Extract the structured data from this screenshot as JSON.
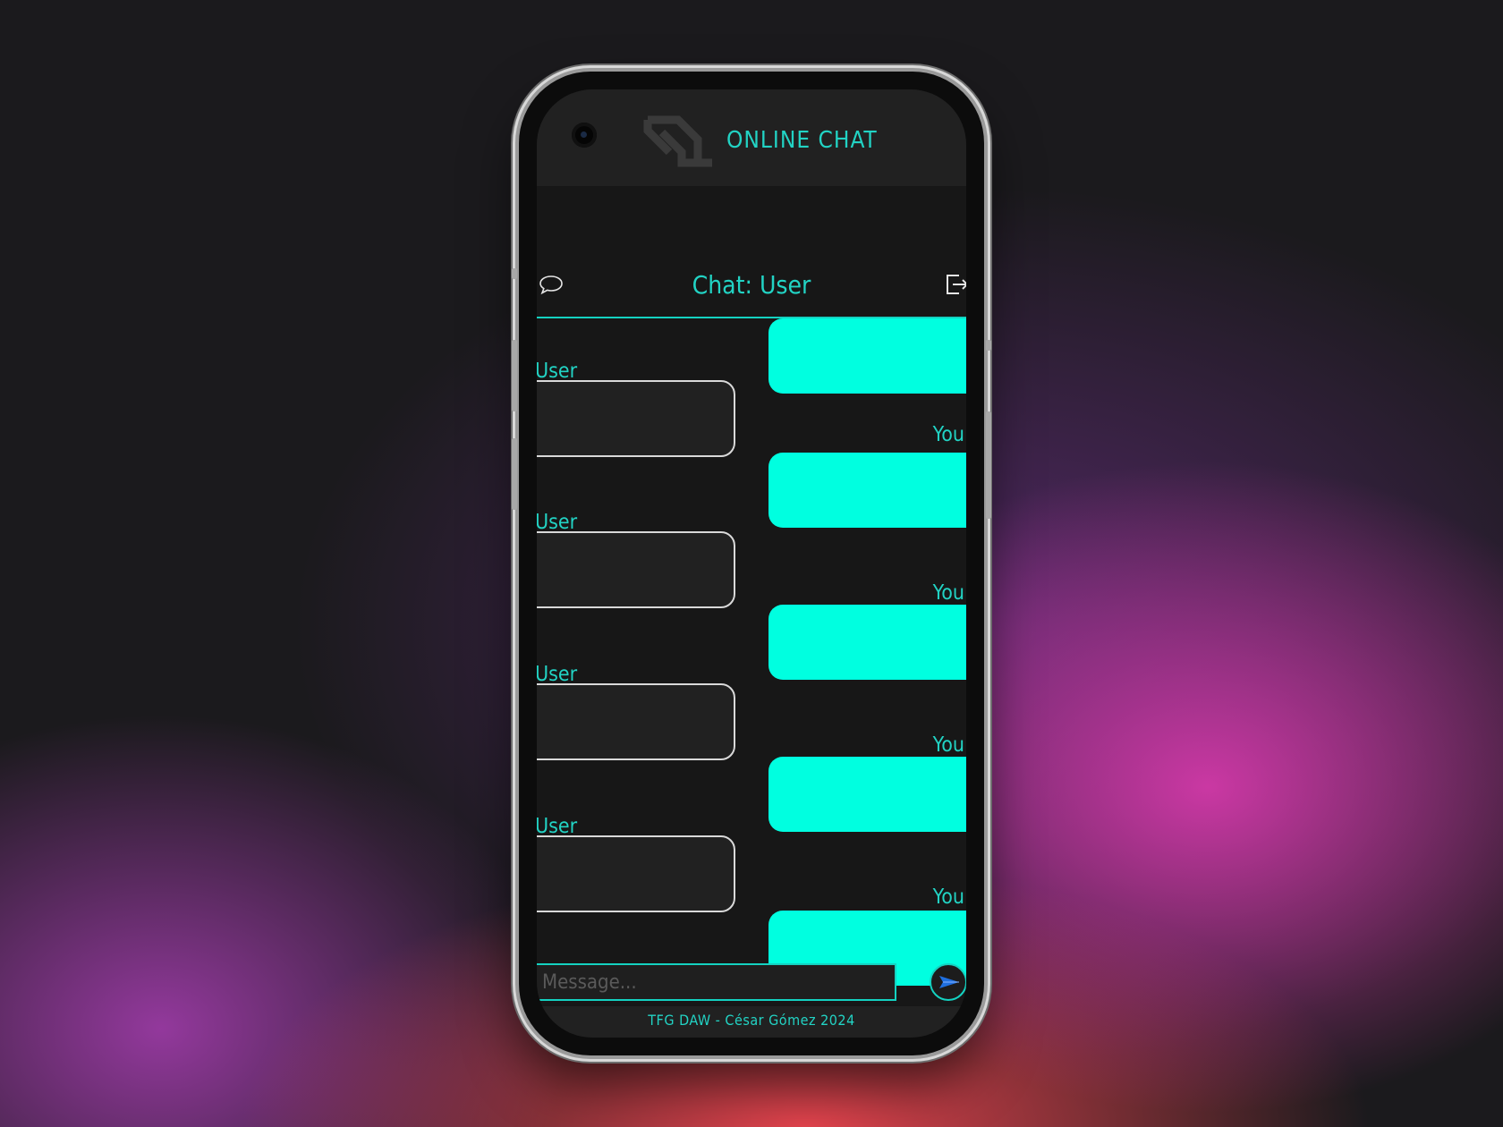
{
  "app": {
    "title": "ONLINE CHAT"
  },
  "chat": {
    "title": "Chat: User"
  },
  "messages": [
    {
      "sender": "You",
      "label": "",
      "text": ""
    },
    {
      "sender": "User",
      "label": "User",
      "text": ""
    },
    {
      "sender": "You",
      "label": "You",
      "text": ""
    },
    {
      "sender": "User",
      "label": "User",
      "text": ""
    },
    {
      "sender": "You",
      "label": "You",
      "text": ""
    },
    {
      "sender": "User",
      "label": "User",
      "text": ""
    },
    {
      "sender": "You",
      "label": "You",
      "text": ""
    },
    {
      "sender": "User",
      "label": "User",
      "text": ""
    },
    {
      "sender": "You",
      "label": "You",
      "text": ""
    }
  ],
  "composer": {
    "placeholder": "Message..."
  },
  "footer": {
    "text": "TFG DAW - César Gómez 2024"
  },
  "icons": {
    "header_logo": "websocket-logo-icon",
    "chat": "speech-bubble-icon",
    "logout": "logout-icon",
    "send": "send-arrow-icon"
  },
  "colors": {
    "accent": "#14d2c1",
    "own_bubble": "#00ffe0",
    "other_bubble": "#212121",
    "screen_bg": "#171717",
    "header_bg": "#212121"
  }
}
